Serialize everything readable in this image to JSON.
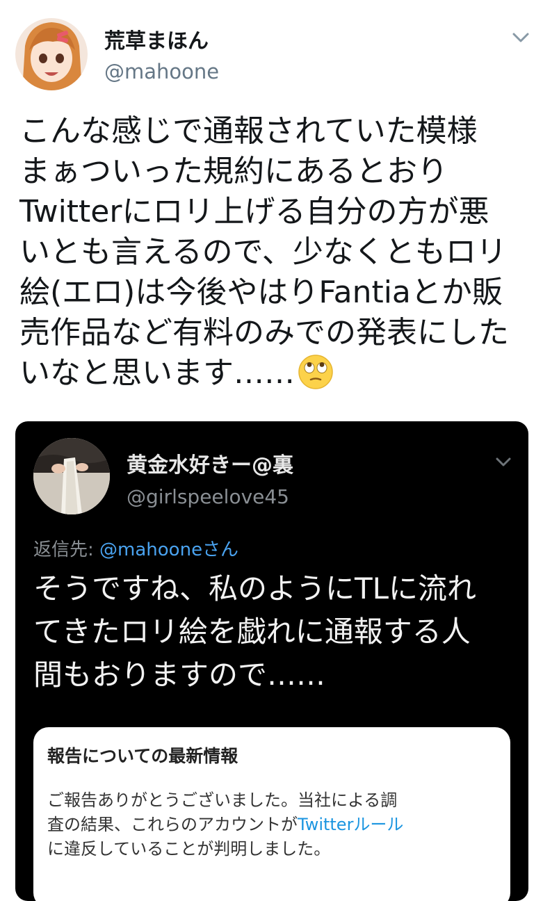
{
  "tweet": {
    "author": {
      "display_name": "荒草まほん",
      "handle": "@mahoone"
    },
    "body_lines": [
      "こんな感じで通報されていた模様",
      "まぁついった規約にあるとおり",
      "Twitterにロリ上げる自分の方が悪",
      "いとも言えるので、少なくともロリ",
      "絵(エロ)は今後やはりFantiaとか販",
      "売作品など有料のみでの発表にした",
      "いなと思います……"
    ],
    "emoji": "face-with-rolling-eyes"
  },
  "quoted": {
    "author": {
      "display_name": "黄金水好きー@裏",
      "handle": "@girlspeelove45"
    },
    "reply_prefix": "返信先: ",
    "reply_mention": "@mahooneさん",
    "body_lines": [
      "そうですね、私のようにTLに流れ",
      "てきたロリ絵を戯れに通報する人",
      "間もおりますので……"
    ],
    "notice": {
      "title": "報告についての最新情報",
      "line1": "ご報告ありがとうございました。当社による調",
      "line2_prefix": "査の結果、これらのアカウントが",
      "line2_link": "Twitterルール",
      "line3": "に違反していることが判明しました。"
    }
  },
  "colors": {
    "link": "#1b95e0",
    "secondary_text": "#657786",
    "quote_bg": "#000000"
  }
}
